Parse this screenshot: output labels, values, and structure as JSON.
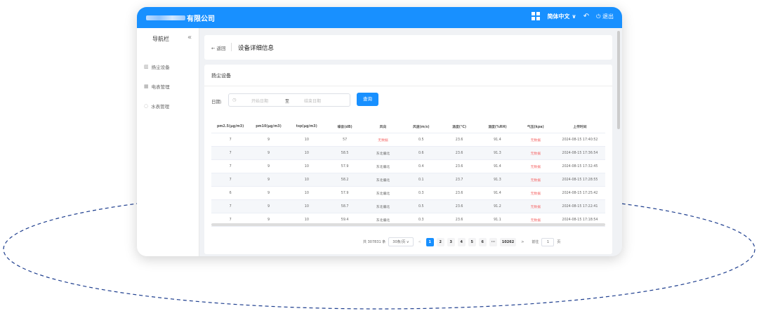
{
  "app": {
    "company_suffix": "有限公司",
    "language": "简体中文",
    "logout": "退出"
  },
  "sidebar": {
    "title": "导航栏",
    "collapse": "«",
    "items": [
      {
        "label": "扬尘设备",
        "icon": "chart-icon"
      },
      {
        "label": "电表管理",
        "icon": "meter-icon"
      },
      {
        "label": "水表管理",
        "icon": "water-icon"
      }
    ]
  },
  "header": {
    "back": "← 返回",
    "title": "设备详细信息"
  },
  "section": {
    "title": "扬尘设备",
    "date_label": "日期:",
    "start_placeholder": "开始日期",
    "to": "至",
    "end_placeholder": "结束日期",
    "query": "查询"
  },
  "table": {
    "columns": [
      "pm2.5(μg/m3)",
      "pm10(μg/m3)",
      "tsp(μg/m3)",
      "噪音(dB)",
      "风向",
      "风速(m/s)",
      "温度(°C)",
      "湿度(%RH)",
      "气压(kpa)",
      "上传时间"
    ],
    "rows": [
      [
        "7",
        "9",
        "10",
        "57",
        "无数据",
        "0.5",
        "23.6",
        "91.4",
        "无数据",
        "2024-08-15 17:40:52"
      ],
      [
        "7",
        "9",
        "10",
        "58.5",
        "东北偏北",
        "0.6",
        "23.6",
        "91.3",
        "无数据",
        "2024-08-15 17:36:54"
      ],
      [
        "7",
        "9",
        "10",
        "57.9",
        "东北偏北",
        "0.4",
        "23.6",
        "91.4",
        "无数据",
        "2024-08-15 17:32:45"
      ],
      [
        "7",
        "9",
        "10",
        "58.2",
        "东北偏北",
        "0.1",
        "23.7",
        "91.3",
        "无数据",
        "2024-08-15 17:28:55"
      ],
      [
        "6",
        "9",
        "10",
        "57.9",
        "东北偏北",
        "0.3",
        "23.6",
        "91.4",
        "无数据",
        "2024-08-15 17:25:42"
      ],
      [
        "7",
        "9",
        "10",
        "58.7",
        "东北偏北",
        "0.5",
        "23.6",
        "91.2",
        "无数据",
        "2024-08-15 17:22:41"
      ],
      [
        "7",
        "9",
        "10",
        "59.4",
        "东北偏北",
        "0.3",
        "23.6",
        "91.1",
        "无数据",
        "2024-08-15 17:18:54"
      ]
    ]
  },
  "pagination": {
    "total": "共 307831 条",
    "page_size": "30条/页",
    "prev": "<",
    "pages": [
      "1",
      "2",
      "3",
      "4",
      "5",
      "6"
    ],
    "ellipsis": "···",
    "last": "10262",
    "next": ">",
    "goto_label": "前往",
    "goto_value": "1",
    "goto_unit": "页"
  },
  "colors": {
    "primary": "#1890ff",
    "no_data": "#f56c6c"
  }
}
